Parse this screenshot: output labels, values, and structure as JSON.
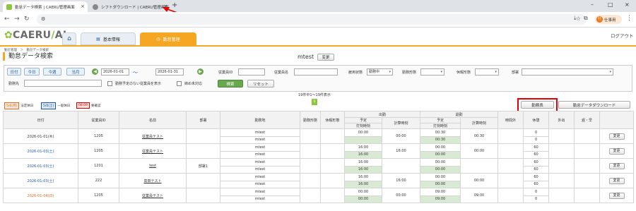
{
  "browser": {
    "tabs": [
      {
        "title": "勤怠データ検索 | CAERU管理画面"
      },
      {
        "title": "シフトダウンロード | CAERU管理画面"
      }
    ],
    "url": "",
    "profile_label": "仕事用",
    "profile_initial": "仕"
  },
  "header": {
    "logo_text": "CAERU",
    "logo_ai": "AI",
    "nav": [
      {
        "label": "基本情報"
      },
      {
        "label": "勤怠管理"
      }
    ],
    "logout": "ログアウト"
  },
  "breadcrumb": "勤怠管理　＞　勤怠データ検索",
  "page_title": "勤怠データ検索",
  "user": {
    "name": "mtest",
    "change_label": "変更"
  },
  "search": {
    "date_label": "日付",
    "buttons": [
      "今日",
      "今週",
      "当月"
    ],
    "from": "2026-01-01",
    "tilde": "〜",
    "to": "2026-01-31",
    "employee_id_label": "従業員ID",
    "employee_name_label": "従業員名",
    "emp_status_label": "雇用状態",
    "emp_status_value": "勤務中",
    "work_type_label": "勤務形態",
    "holiday_type_label": "休暇形態",
    "dept_label": "部署",
    "work_place_label": "勤務先",
    "chk_no_schedule": "勤務予定のない従業員を表示",
    "chk_unhandled": "締め未対応",
    "search_btn": "検索",
    "reset_btn": "リセット"
  },
  "result_count": "19件中1〜19件表示",
  "page_num": "1",
  "legend": [
    {
      "box": "5/6(月)",
      "text": "法定休日",
      "color": "#e06c1f"
    },
    {
      "box": "5/0(土)",
      "text": "一般休日",
      "color": "#1a56a8"
    },
    {
      "box": "08:09",
      "text": "要確認",
      "color": "#c00"
    }
  ],
  "action_buttons": {
    "attendance": "勤務表",
    "download": "勤怠データダウンロード"
  },
  "table": {
    "headers": {
      "date": "日付",
      "empid": "従業員ID",
      "name": "名前",
      "dept": "部署",
      "place": "勤務地",
      "worktype": "勤務形態",
      "holtype": "休暇形態",
      "in": "出勤",
      "out": "退勤",
      "plan": "予定",
      "stamp": "打刻時刻",
      "calc": "計算時刻",
      "overtime": "時間外",
      "rest": "休憩",
      "goout": "外出",
      "late": "遅・早"
    },
    "rows": [
      {
        "date": "2026-01-01(木)",
        "cls": "",
        "empid": "1205",
        "name": "従業員テスト",
        "dept": "",
        "places": [
          "mtest",
          "mtest"
        ],
        "in_plan": [
          "00:00",
          ""
        ],
        "in_calc": "00:00",
        "out_plan": [
          "00:30",
          "00:30"
        ],
        "out_calc": "00:30",
        "rest": [
          "0",
          "0"
        ],
        "edit": "変更"
      },
      {
        "date": "2026-01-03(土)",
        "cls": "sat",
        "empid": "1205",
        "name": "従業員テスト",
        "dept": "",
        "places": [
          "mtest",
          "mtest"
        ],
        "in_plan": [
          "16:00",
          "16:00"
        ],
        "in_calc": "16:00",
        "out_plan": [
          "00:00",
          "00:00"
        ],
        "out_calc": "00:00",
        "rest": [
          "60",
          "60"
        ],
        "edit": "変更"
      },
      {
        "date": "2026-01-03(土)",
        "cls": "sat",
        "empid": "1201",
        "name": "test",
        "dept": "部署1",
        "places": [
          "mtest",
          "mtest"
        ],
        "in_plan": [
          "16:00",
          "16:00"
        ],
        "in_calc": "",
        "out_plan": [
          "00:00",
          "00:00"
        ],
        "out_calc": "",
        "rest": [
          "60",
          "60"
        ],
        "edit": "変更"
      },
      {
        "date": "2026-01-03(土)",
        "cls": "sat",
        "empid": "222",
        "name": "高田テスト",
        "dept": "",
        "places": [
          "mtest",
          "mtest"
        ],
        "in_plan": [
          "16:00",
          "16:00"
        ],
        "in_calc": "16:00",
        "out_plan": [
          "00:00",
          "00:00"
        ],
        "out_calc": "00:00",
        "rest": [
          "60",
          "60"
        ],
        "edit": "変更"
      },
      {
        "date": "2026-01-04(日)",
        "cls": "sun",
        "empid": "1205",
        "name": "従業員テスト",
        "dept": "",
        "places": [
          "mtest",
          "mtest"
        ],
        "in_plan": [
          "00:00",
          "00:00"
        ],
        "in_calc": "00:00",
        "out_plan": [
          "09:00",
          "09:00"
        ],
        "out_calc": "09:00",
        "rest": [
          "0",
          "0"
        ],
        "edit": "変更"
      }
    ]
  }
}
